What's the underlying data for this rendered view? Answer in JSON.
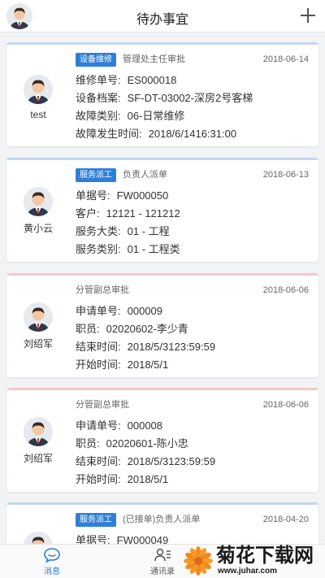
{
  "header": {
    "title": "待办事宜"
  },
  "cards": [
    {
      "tag": "设备维修",
      "kind": "管理处主任审批",
      "date": "2018-06-14",
      "person": "test",
      "rows": [
        {
          "label": "维修单号:",
          "value": "ES000018"
        },
        {
          "label": "设备档案:",
          "value": "SF-DT-03002-深房2号客梯"
        },
        {
          "label": "故障类别:",
          "value": "06-日常维修"
        },
        {
          "label": "故障发生时间:",
          "value": "2018/6/1416:31:00"
        }
      ]
    },
    {
      "tag": "服务派工",
      "kind": "负责人派单",
      "date": "2018-06-13",
      "person": "黄小云",
      "rows": [
        {
          "label": "单据号:",
          "value": "FW000050"
        },
        {
          "label": "客户:",
          "value": "12121 - 121212"
        },
        {
          "label": "服务大类:",
          "value": "01 - 工程"
        },
        {
          "label": "服务类别:",
          "value": "01 - 工程类"
        }
      ]
    },
    {
      "tag": "",
      "kind": "分管副总审批",
      "date": "2018-06-06",
      "person": "刘绍军",
      "rows": [
        {
          "label": "申请单号:",
          "value": "000009"
        },
        {
          "label": "职员:",
          "value": "02020602-李少青"
        },
        {
          "label": "结束时间:",
          "value": "2018/5/3123:59:59"
        },
        {
          "label": "开始时间:",
          "value": "2018/5/1"
        }
      ]
    },
    {
      "tag": "",
      "kind": "分管副总审批",
      "date": "2018-06-06",
      "person": "刘绍军",
      "rows": [
        {
          "label": "申请单号:",
          "value": "000008"
        },
        {
          "label": "职员:",
          "value": "02020601-陈小忠"
        },
        {
          "label": "结束时间:",
          "value": "2018/5/3123:59:59"
        },
        {
          "label": "开始时间:",
          "value": "2018/5/1"
        }
      ]
    },
    {
      "tag": "服务派工",
      "kind": "(已接单)负责人派单",
      "date": "2018-04-20",
      "person": "",
      "rows": [
        {
          "label": "单据号:",
          "value": "FW000049"
        }
      ]
    }
  ],
  "tabbar": {
    "messages": "消息",
    "contacts": "通讯录"
  },
  "watermark": {
    "text": "菊花下载网",
    "url": "www.juhar.com"
  },
  "colors": {
    "accent": "#2f7fd8",
    "blue_bar": "#c3d6ee",
    "pink_bar": "#f3c9cc"
  },
  "icons": {
    "avatar": "avatar-icon",
    "plus": "plus-icon",
    "messages": "chat-bubble-icon",
    "contacts": "contacts-icon"
  }
}
